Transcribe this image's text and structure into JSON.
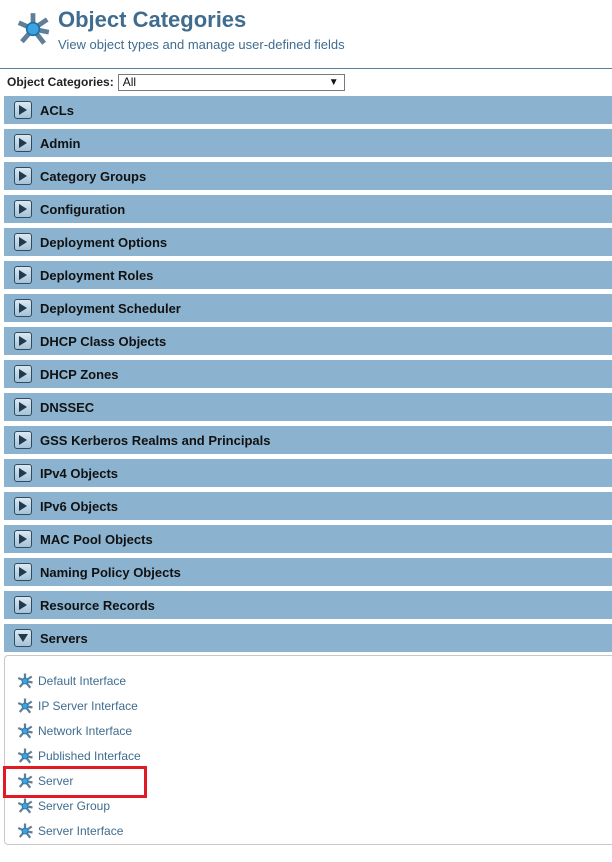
{
  "header": {
    "logo_icon": "object-categories-icon",
    "title": "Object Categories",
    "subtitle": "View object types and manage user-defined fields"
  },
  "filter": {
    "label": "Object Categories:",
    "selected": "All"
  },
  "categories": [
    {
      "label": "ACLs",
      "state": "collapsed"
    },
    {
      "label": "Admin",
      "state": "collapsed"
    },
    {
      "label": "Category Groups",
      "state": "collapsed"
    },
    {
      "label": "Configuration",
      "state": "collapsed"
    },
    {
      "label": "Deployment Options",
      "state": "collapsed"
    },
    {
      "label": "Deployment Roles",
      "state": "collapsed"
    },
    {
      "label": "Deployment Scheduler",
      "state": "collapsed"
    },
    {
      "label": "DHCP Class Objects",
      "state": "collapsed"
    },
    {
      "label": "DHCP Zones",
      "state": "collapsed"
    },
    {
      "label": "DNSSEC",
      "state": "collapsed"
    },
    {
      "label": "GSS Kerberos Realms and Principals",
      "state": "collapsed"
    },
    {
      "label": "IPv4 Objects",
      "state": "collapsed"
    },
    {
      "label": "IPv6 Objects",
      "state": "collapsed"
    },
    {
      "label": "MAC Pool Objects",
      "state": "collapsed"
    },
    {
      "label": "Naming Policy Objects",
      "state": "collapsed"
    },
    {
      "label": "Resource Records",
      "state": "collapsed"
    },
    {
      "label": "Servers",
      "state": "expanded"
    }
  ],
  "servers_items": [
    {
      "label": "Default Interface",
      "icon": "object-type-icon"
    },
    {
      "label": "IP Server Interface",
      "icon": "object-type-icon"
    },
    {
      "label": "Network Interface",
      "icon": "object-type-icon"
    },
    {
      "label": "Published Interface",
      "icon": "object-type-icon"
    },
    {
      "label": "Server",
      "icon": "object-type-icon",
      "highlighted": true
    },
    {
      "label": "Server Group",
      "icon": "object-type-icon"
    },
    {
      "label": "Server Interface",
      "icon": "object-type-icon"
    }
  ],
  "colors": {
    "title": "#3f6c8f",
    "category_bar": "#8bb3cf",
    "link": "#3f6c8f",
    "highlight": "#e01b24"
  }
}
